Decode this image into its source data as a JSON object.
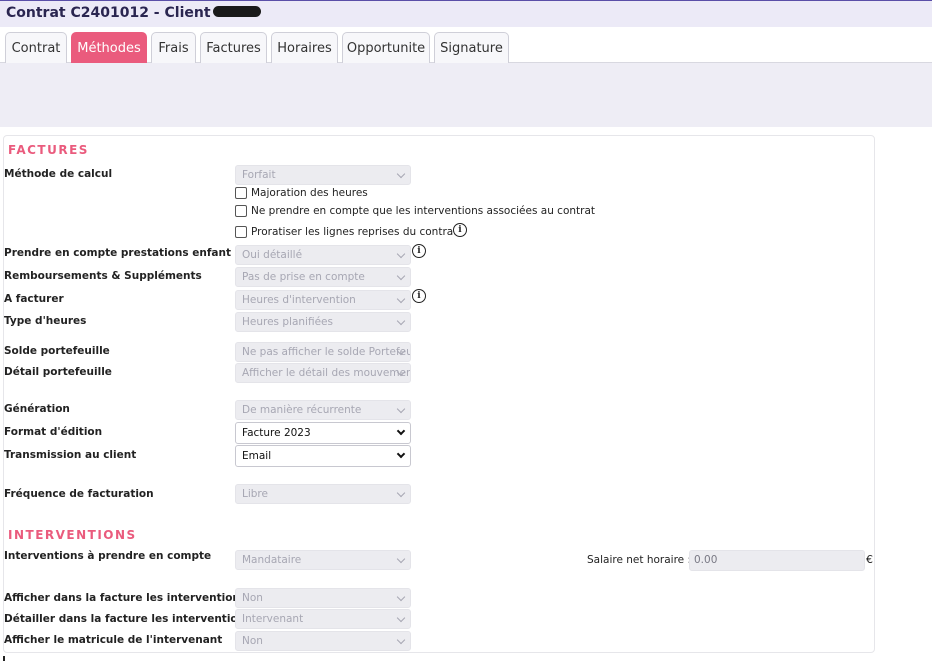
{
  "window": {
    "title": "Contrat C2401012 - Client"
  },
  "tabs": [
    {
      "label": "Contrat"
    },
    {
      "label": "Méthodes"
    },
    {
      "label": "Frais"
    },
    {
      "label": "Factures"
    },
    {
      "label": "Horaires"
    },
    {
      "label": "Opportunite"
    },
    {
      "label": "Signature"
    }
  ],
  "factures": {
    "section_title": "FACTURES",
    "methode_calcul": {
      "label": "Méthode de calcul",
      "value": "Forfait"
    },
    "checkboxes": {
      "majoration": "Majoration des heures",
      "interventions_associees": "Ne prendre en compte que les interventions associées au contrat",
      "proratiser": "Proratiser les lignes reprises du contrat"
    },
    "prestations_enfant": {
      "label": "Prendre en compte prestations enfant",
      "value": "Oui détaillé"
    },
    "remboursements": {
      "label": "Remboursements & Suppléments",
      "value": "Pas de prise en compte"
    },
    "a_facturer": {
      "label": "A facturer",
      "value": "Heures d'intervention"
    },
    "type_heures": {
      "label": "Type d'heures",
      "value": "Heures planifiées"
    },
    "solde_portefeuille": {
      "label": "Solde portefeuille",
      "value": "Ne pas afficher le solde Portefeuille"
    },
    "detail_portefeuille": {
      "label": "Détail portefeuille",
      "value": "Afficher le détail des mouvements"
    },
    "generation": {
      "label": "Génération",
      "value": "De manière récurrente"
    },
    "format_edition": {
      "label": "Format d'édition",
      "value": "Facture 2023"
    },
    "transmission": {
      "label": "Transmission au client",
      "value": "Email"
    },
    "frequence": {
      "label": "Fréquence de facturation",
      "value": "Libre"
    }
  },
  "interventions": {
    "section_title": "INTERVENTIONS",
    "a_prendre": {
      "label": "Interventions à prendre en compte",
      "value": "Mandataire"
    },
    "salaire": {
      "label": "Salaire net horaire :",
      "value": "0.00",
      "unit": "€"
    },
    "afficher_facture": {
      "label": "Afficher dans la facture les interventions",
      "value": "Non"
    },
    "detailler_par": {
      "label": "Détailler dans la facture les interventions par",
      "value": "Intervenant"
    },
    "matricule": {
      "label": "Afficher le matricule de l'intervenant",
      "value": "Non"
    }
  }
}
